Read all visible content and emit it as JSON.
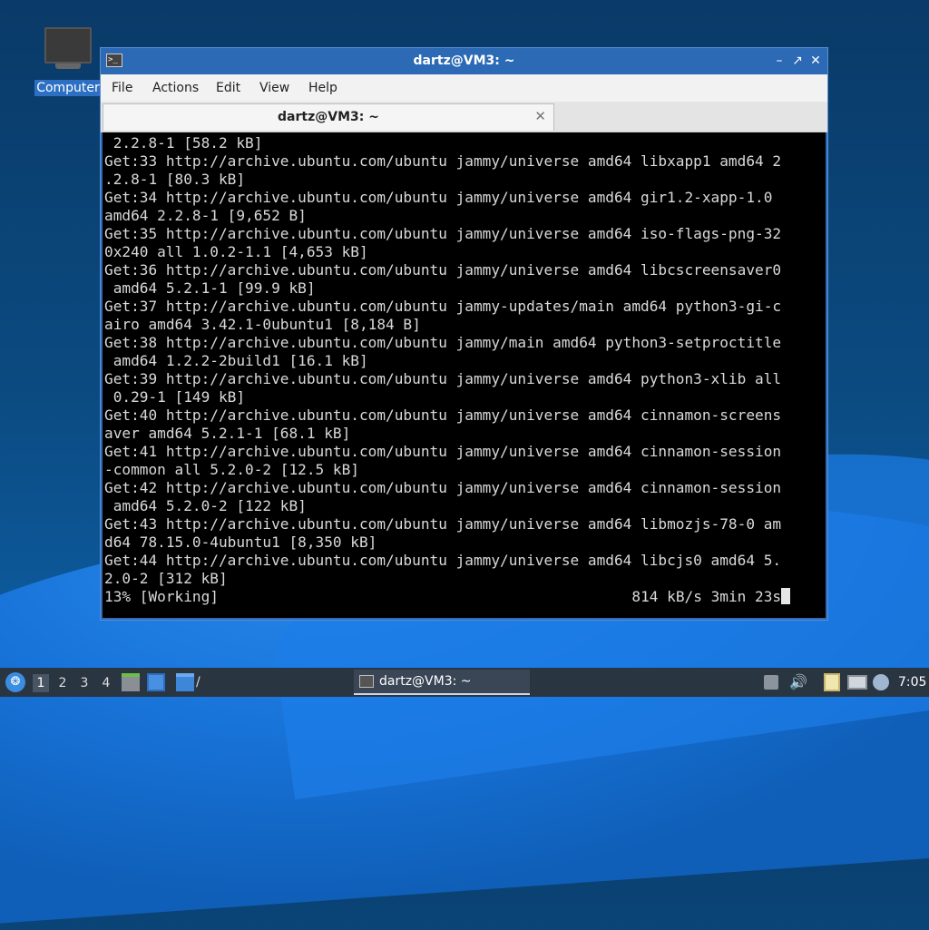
{
  "desktop": {
    "icons": [
      {
        "label": "Computer",
        "icon": "computer-icon"
      }
    ]
  },
  "window": {
    "title": "dartz@VM3: ~",
    "menu": [
      "File",
      "Actions",
      "Edit",
      "View",
      "Help"
    ],
    "tab": {
      "title": "dartz@VM3: ~"
    },
    "terminal": {
      "lines": [
        " 2.2.8-1 [58.2 kB]",
        "Get:33 http://archive.ubuntu.com/ubuntu jammy/universe amd64 libxapp1 amd64 2",
        ".2.8-1 [80.3 kB]",
        "Get:34 http://archive.ubuntu.com/ubuntu jammy/universe amd64 gir1.2-xapp-1.0",
        "amd64 2.2.8-1 [9,652 B]",
        "Get:35 http://archive.ubuntu.com/ubuntu jammy/universe amd64 iso-flags-png-32",
        "0x240 all 1.0.2-1.1 [4,653 kB]",
        "Get:36 http://archive.ubuntu.com/ubuntu jammy/universe amd64 libcscreensaver0",
        " amd64 5.2.1-1 [99.9 kB]",
        "Get:37 http://archive.ubuntu.com/ubuntu jammy-updates/main amd64 python3-gi-c",
        "airo amd64 3.42.1-0ubuntu1 [8,184 B]",
        "Get:38 http://archive.ubuntu.com/ubuntu jammy/main amd64 python3-setproctitle",
        " amd64 1.2.2-2build1 [16.1 kB]",
        "Get:39 http://archive.ubuntu.com/ubuntu jammy/universe amd64 python3-xlib all",
        " 0.29-1 [149 kB]",
        "Get:40 http://archive.ubuntu.com/ubuntu jammy/universe amd64 cinnamon-screens",
        "aver amd64 5.2.1-1 [68.1 kB]",
        "Get:41 http://archive.ubuntu.com/ubuntu jammy/universe amd64 cinnamon-session",
        "-common all 5.2.0-2 [12.5 kB]",
        "Get:42 http://archive.ubuntu.com/ubuntu jammy/universe amd64 cinnamon-session",
        " amd64 5.2.0-2 [122 kB]",
        "Get:43 http://archive.ubuntu.com/ubuntu jammy/universe amd64 libmozjs-78-0 am",
        "d64 78.15.0-4ubuntu1 [8,350 kB]",
        "Get:44 http://archive.ubuntu.com/ubuntu jammy/universe amd64 libcjs0 amd64 5.",
        "2.0-2 [312 kB]"
      ],
      "status_left": "13% [Working]",
      "status_right": "814 kB/s 3min 23s"
    }
  },
  "taskbar": {
    "workspaces": [
      "1",
      "2",
      "3",
      "4"
    ],
    "active_workspace": "1",
    "launcher_label": "/",
    "task": {
      "title": "dartz@VM3: ~"
    },
    "clock": "7:05"
  },
  "colors": {
    "titlebar": "#2c6ab6",
    "terminal_bg": "#000000",
    "terminal_fg": "#d9d9d9",
    "taskbar_bg": "#2a3542"
  }
}
